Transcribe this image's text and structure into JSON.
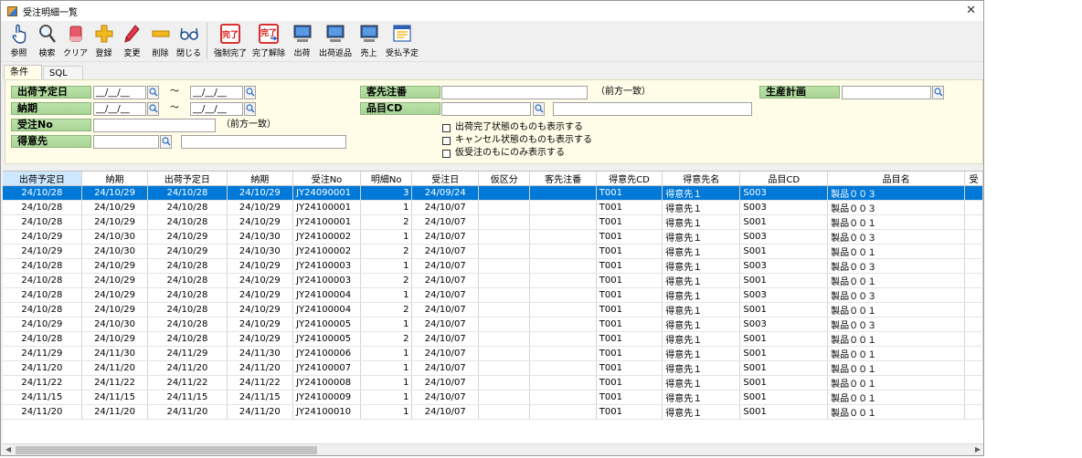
{
  "window": {
    "title": "受注明細一覧"
  },
  "toolbar": {
    "buttons": [
      {
        "label": "参照",
        "icon": "hand-pointer-icon"
      },
      {
        "label": "検索",
        "icon": "magnifier-icon"
      },
      {
        "label": "クリア",
        "icon": "eraser-icon"
      },
      {
        "label": "登録",
        "icon": "plus-icon"
      },
      {
        "label": "変更",
        "icon": "pencil-icon"
      },
      {
        "label": "削除",
        "icon": "minus-icon"
      },
      {
        "label": "閉じる",
        "icon": "glasses-icon"
      },
      {
        "label": "強制完了",
        "icon": "complete-stamp-icon",
        "stamp": "完了"
      },
      {
        "label": "完了解除",
        "icon": "complete-release-icon",
        "stamp": "完了"
      },
      {
        "label": "出荷",
        "icon": "computer-icon"
      },
      {
        "label": "出荷返品",
        "icon": "computer-return-icon"
      },
      {
        "label": "売上",
        "icon": "computer-sales-icon"
      },
      {
        "label": "受払予定",
        "icon": "calendar-window-icon"
      }
    ]
  },
  "tabs": [
    {
      "label": "条件"
    },
    {
      "label": "SQL"
    }
  ],
  "conditions": {
    "ship_date": {
      "label": "出荷予定日",
      "from": "__/__/__",
      "to": "__/__/__"
    },
    "delivery": {
      "label": "納期",
      "from": "__/__/__",
      "to": "__/__/__"
    },
    "range_sep": "～",
    "order_no": {
      "label": "受注No",
      "value": "",
      "note": "（前方一致）"
    },
    "customer": {
      "label": "得意先",
      "code": "",
      "name": ""
    },
    "cust_order": {
      "label": "客先注番",
      "value": "",
      "note": "（前方一致）"
    },
    "item_cd": {
      "label": "品目CD",
      "code": "",
      "name": ""
    },
    "production_plan": {
      "label": "生産計画",
      "value": ""
    },
    "checkboxes": [
      {
        "label": "出荷完了状態のものも表示する",
        "checked": false
      },
      {
        "label": "キャンセル状態のものも表示する",
        "checked": false
      },
      {
        "label": "仮受注のもにのみ表示する",
        "checked": false
      }
    ]
  },
  "grid": {
    "columns": [
      "出荷予定日",
      "納期",
      "出荷予定日",
      "納期",
      "受注No",
      "明細No",
      "受注日",
      "仮区分",
      "客先注番",
      "得意先CD",
      "得意先名",
      "品目CD",
      "品目名",
      "受"
    ],
    "rows": [
      [
        "24/10/28",
        "24/10/29",
        "24/10/28",
        "24/10/29",
        "JY24090001",
        "3",
        "24/09/24",
        "",
        "",
        "T001",
        "得意先１",
        "S003",
        "製品００３"
      ],
      [
        "24/10/28",
        "24/10/29",
        "24/10/28",
        "24/10/29",
        "JY24100001",
        "1",
        "24/10/07",
        "",
        "",
        "T001",
        "得意先１",
        "S003",
        "製品００３"
      ],
      [
        "24/10/28",
        "24/10/29",
        "24/10/28",
        "24/10/29",
        "JY24100001",
        "2",
        "24/10/07",
        "",
        "",
        "T001",
        "得意先１",
        "S001",
        "製品００１"
      ],
      [
        "24/10/29",
        "24/10/30",
        "24/10/29",
        "24/10/30",
        "JY24100002",
        "1",
        "24/10/07",
        "",
        "",
        "T001",
        "得意先１",
        "S003",
        "製品００３"
      ],
      [
        "24/10/29",
        "24/10/30",
        "24/10/29",
        "24/10/30",
        "JY24100002",
        "2",
        "24/10/07",
        "",
        "",
        "T001",
        "得意先１",
        "S001",
        "製品００１"
      ],
      [
        "24/10/28",
        "24/10/29",
        "24/10/28",
        "24/10/29",
        "JY24100003",
        "1",
        "24/10/07",
        "",
        "",
        "T001",
        "得意先１",
        "S003",
        "製品００３"
      ],
      [
        "24/10/28",
        "24/10/29",
        "24/10/28",
        "24/10/29",
        "JY24100003",
        "2",
        "24/10/07",
        "",
        "",
        "T001",
        "得意先１",
        "S001",
        "製品００１"
      ],
      [
        "24/10/28",
        "24/10/29",
        "24/10/28",
        "24/10/29",
        "JY24100004",
        "1",
        "24/10/07",
        "",
        "",
        "T001",
        "得意先１",
        "S003",
        "製品００３"
      ],
      [
        "24/10/28",
        "24/10/29",
        "24/10/28",
        "24/10/29",
        "JY24100004",
        "2",
        "24/10/07",
        "",
        "",
        "T001",
        "得意先１",
        "S001",
        "製品００１"
      ],
      [
        "24/10/29",
        "24/10/30",
        "24/10/28",
        "24/10/29",
        "JY24100005",
        "1",
        "24/10/07",
        "",
        "",
        "T001",
        "得意先１",
        "S003",
        "製品００３"
      ],
      [
        "24/10/28",
        "24/10/29",
        "24/10/28",
        "24/10/29",
        "JY24100005",
        "2",
        "24/10/07",
        "",
        "",
        "T001",
        "得意先１",
        "S001",
        "製品００１"
      ],
      [
        "24/11/29",
        "24/11/30",
        "24/11/29",
        "24/11/30",
        "JY24100006",
        "1",
        "24/10/07",
        "",
        "",
        "T001",
        "得意先１",
        "S001",
        "製品００１"
      ],
      [
        "24/11/20",
        "24/11/20",
        "24/11/20",
        "24/11/20",
        "JY24100007",
        "1",
        "24/10/07",
        "",
        "",
        "T001",
        "得意先１",
        "S001",
        "製品００１"
      ],
      [
        "24/11/22",
        "24/11/22",
        "24/11/22",
        "24/11/22",
        "JY24100008",
        "1",
        "24/10/07",
        "",
        "",
        "T001",
        "得意先１",
        "S001",
        "製品００１"
      ],
      [
        "24/11/15",
        "24/11/15",
        "24/11/15",
        "24/11/15",
        "JY24100009",
        "1",
        "24/10/07",
        "",
        "",
        "T001",
        "得意先１",
        "S001",
        "製品００１"
      ],
      [
        "24/11/20",
        "24/11/20",
        "24/11/20",
        "24/11/20",
        "JY24100010",
        "1",
        "24/10/07",
        "",
        "",
        "T001",
        "得意先１",
        "S001",
        "製品００１"
      ]
    ],
    "selected_row": 0,
    "sorted_column": 0
  },
  "scroll_arrows": {
    "left": "◀",
    "right": "▶"
  },
  "colors": {
    "selection": "#0078d7",
    "label_green": "#a7d494",
    "panel_bg": "#fffde8"
  }
}
